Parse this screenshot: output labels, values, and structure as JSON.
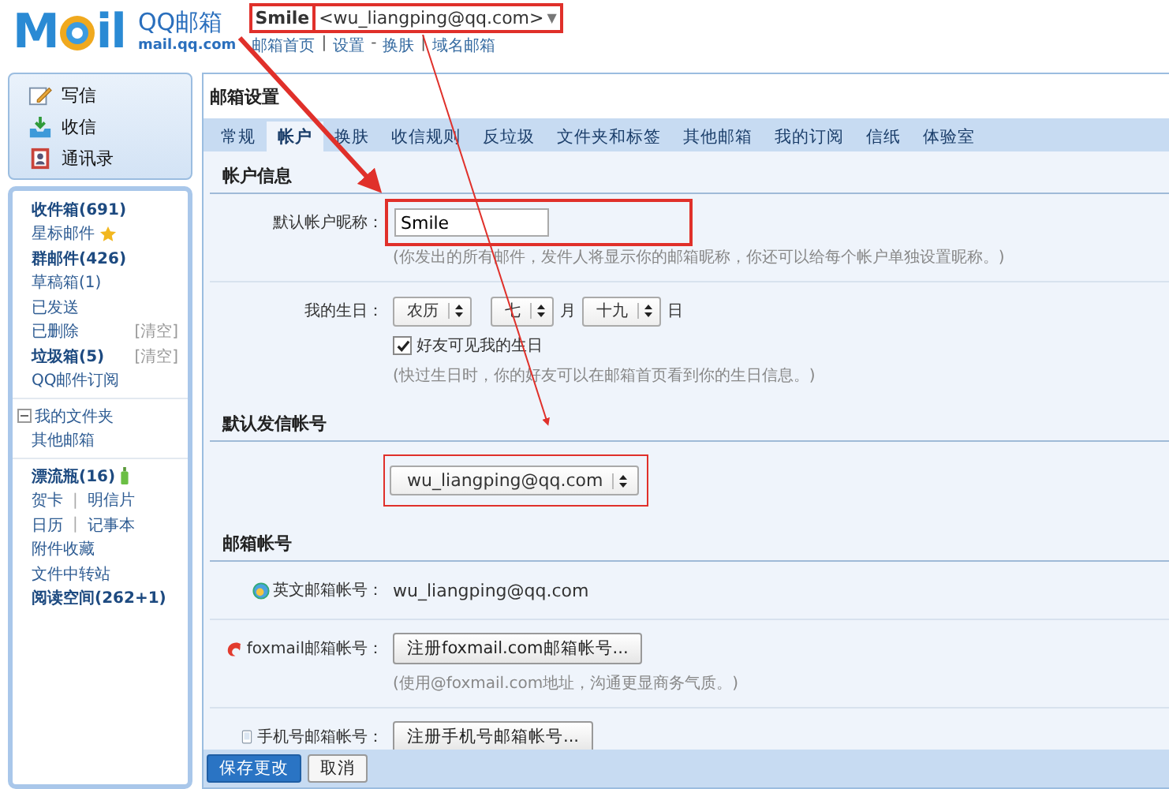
{
  "header": {
    "logo": {
      "left": "M",
      "right": "il"
    },
    "brand": "QQ邮箱",
    "domain": "mail.qq.com",
    "nickname": {
      "text": "Smile",
      "highlighted": true
    },
    "address": {
      "text": "<wu_liangping@qq.com>",
      "highlighted": true
    },
    "caret": "▼",
    "links": [
      {
        "label": "邮箱首页",
        "sep_after": "|"
      },
      {
        "label": "设置",
        "sep_after": "-"
      },
      {
        "label": "换肤",
        "sep_after": "|"
      },
      {
        "label": "域名邮箱"
      }
    ]
  },
  "sidebar": {
    "actions": [
      {
        "label": "写信"
      },
      {
        "label": "收信"
      },
      {
        "label": "通讯录"
      }
    ],
    "groups": [
      [
        {
          "kind": "link",
          "label": "收件箱(691)",
          "bold": true
        },
        {
          "kind": "starred",
          "label": "星标邮件",
          "bold": false
        },
        {
          "kind": "link",
          "label": "群邮件(426)",
          "bold": true
        },
        {
          "kind": "link",
          "label": "草稿箱(1)",
          "bold": false
        },
        {
          "kind": "link",
          "label": "已发送",
          "bold": false
        },
        {
          "kind": "link",
          "label": "已删除",
          "bold": false,
          "action": "[清空]"
        },
        {
          "kind": "link",
          "label": "垃圾箱(5)",
          "bold": true,
          "action": "[清空]"
        },
        {
          "kind": "link",
          "label": "QQ邮件订阅",
          "bold": false
        }
      ],
      [
        {
          "kind": "folder",
          "label": "我的文件夹",
          "expanded": true
        },
        {
          "kind": "link",
          "label": "其他邮箱",
          "bold": false
        }
      ],
      [
        {
          "kind": "bottle",
          "label": "漂流瓶(16)",
          "bold": true
        },
        {
          "kind": "pair",
          "labels": [
            "贺卡",
            "明信片"
          ],
          "sep": "|"
        },
        {
          "kind": "pair",
          "labels": [
            "日历",
            "记事本"
          ],
          "sep": "|"
        },
        {
          "kind": "link",
          "label": "附件收藏",
          "bold": false
        },
        {
          "kind": "link",
          "label": "文件中转站",
          "bold": false
        },
        {
          "kind": "link",
          "label": "阅读空间(262+1)",
          "bold": true
        }
      ]
    ]
  },
  "main": {
    "title": "邮箱设置",
    "tabs": [
      {
        "label": "常规",
        "selected": false
      },
      {
        "label": "帐户",
        "selected": true
      },
      {
        "label": "换肤",
        "selected": false
      },
      {
        "label": "收信规则",
        "selected": false
      },
      {
        "label": "反垃圾",
        "selected": false
      },
      {
        "label": "文件夹和标签",
        "selected": false
      },
      {
        "label": "其他邮箱",
        "selected": false
      },
      {
        "label": "我的订阅",
        "selected": false
      },
      {
        "label": "信纸",
        "selected": false
      },
      {
        "label": "体验室",
        "selected": false
      }
    ],
    "sections": [
      {
        "title": "帐户信息",
        "rows": [
          {
            "kind": "input",
            "label": "默认帐户昵称：",
            "value": "Smile",
            "highlighted": true,
            "hint": "(你发出的所有邮件，发件人将显示你的邮箱昵称，你还可以给每个帐户单独设置昵称。)"
          },
          {
            "kind": "birthday",
            "label": "我的生日：",
            "calendar": "农历",
            "month": "七",
            "month_unit": "月",
            "day": "十九",
            "day_unit": "日",
            "checkbox": {
              "label": "好友可见我的生日",
              "checked": true
            },
            "hint": "(快过生日时，你的好友可以在邮箱首页看到你的生日信息。)"
          }
        ]
      },
      {
        "title": "默认发信帐号",
        "rows": [
          {
            "kind": "select",
            "value": "wu_liangping@qq.com",
            "highlighted": true
          }
        ]
      },
      {
        "title": "邮箱帐号",
        "rows": [
          {
            "kind": "text",
            "label": "英文邮箱帐号：",
            "value": "wu_liangping@qq.com"
          },
          {
            "kind": "button",
            "label": "foxmail邮箱帐号：",
            "button": "注册foxmail.com邮箱帐号...",
            "hint": "(使用@foxmail.com地址，沟通更显商务气质。)"
          },
          {
            "kind": "button",
            "label": "手机号邮箱帐号：",
            "button": "注册手机号邮箱帐号..."
          }
        ]
      }
    ],
    "footer": {
      "buttons": [
        {
          "label": "保存更改",
          "primary": true
        },
        {
          "label": "取消",
          "primary": false
        }
      ]
    }
  }
}
